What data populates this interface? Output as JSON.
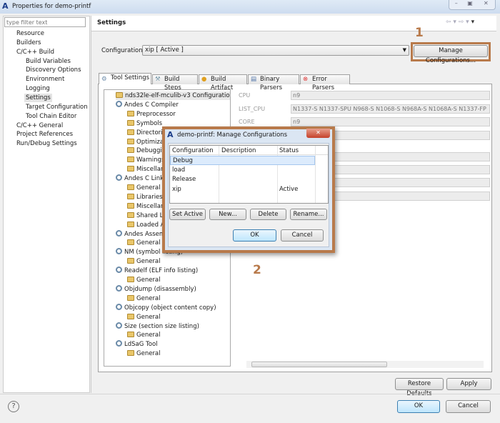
{
  "window": {
    "title": "Properties for demo-printf",
    "app_icon": "A"
  },
  "left": {
    "filter_placeholder": "type filter text",
    "items": [
      "Resource",
      "Builders",
      "C/C++ Build",
      "Build Variables",
      "Discovery Options",
      "Environment",
      "Logging",
      "Settings",
      "Target Configuration",
      "Tool Chain Editor",
      "C/C++ General",
      "Project References",
      "Run/Debug Settings"
    ]
  },
  "main": {
    "header": "Settings",
    "config_label": "Configuration:",
    "config_value": "xip  [ Active ]",
    "manage_button": "Manage Configurations...",
    "tabs": [
      "Tool Settings",
      "Build Steps",
      "Build Artifact",
      "Binary Parsers",
      "Error Parsers"
    ],
    "tree": [
      {
        "label": "nds32le-elf-mculib-v3 Configurations",
        "level": 0,
        "icon": "folder"
      },
      {
        "label": "Andes C Compiler",
        "level": 0,
        "icon": "gear"
      },
      {
        "label": "Preprocessor",
        "level": 1,
        "icon": "folder"
      },
      {
        "label": "Symbols",
        "level": 1,
        "icon": "folder"
      },
      {
        "label": "Directories",
        "level": 1,
        "icon": "folder"
      },
      {
        "label": "Optimization",
        "level": 1,
        "icon": "folder"
      },
      {
        "label": "Debugging",
        "level": 1,
        "icon": "folder"
      },
      {
        "label": "Warnings",
        "level": 1,
        "icon": "folder"
      },
      {
        "label": "Miscellaneous",
        "level": 1,
        "icon": "folder"
      },
      {
        "label": "Andes C Linker",
        "level": 0,
        "icon": "gear"
      },
      {
        "label": "General",
        "level": 1,
        "icon": "folder"
      },
      {
        "label": "Libraries",
        "level": 1,
        "icon": "folder"
      },
      {
        "label": "Miscellaneous",
        "level": 1,
        "icon": "folder"
      },
      {
        "label": "Shared Libraries",
        "level": 1,
        "icon": "folder"
      },
      {
        "label": "Loaded A",
        "level": 1,
        "icon": "folder"
      },
      {
        "label": "Andes Assembler",
        "level": 0,
        "icon": "gear"
      },
      {
        "label": "General",
        "level": 1,
        "icon": "folder"
      },
      {
        "label": "NM (symbol listing)",
        "level": 0,
        "icon": "gear"
      },
      {
        "label": "General",
        "level": 1,
        "icon": "folder"
      },
      {
        "label": "Readelf (ELF info listing)",
        "level": 0,
        "icon": "gear"
      },
      {
        "label": "General",
        "level": 1,
        "icon": "folder"
      },
      {
        "label": "Objdump (disassembly)",
        "level": 0,
        "icon": "gear"
      },
      {
        "label": "General",
        "level": 1,
        "icon": "folder"
      },
      {
        "label": "Objcopy (object content copy)",
        "level": 0,
        "icon": "gear"
      },
      {
        "label": "General",
        "level": 1,
        "icon": "folder"
      },
      {
        "label": "Size (section size listing)",
        "level": 0,
        "icon": "gear"
      },
      {
        "label": "General",
        "level": 1,
        "icon": "folder"
      },
      {
        "label": "LdSaG Tool",
        "level": 0,
        "icon": "gear"
      },
      {
        "label": "General",
        "level": 1,
        "icon": "folder"
      }
    ],
    "properties": [
      {
        "label": "CPU",
        "value": "n9"
      },
      {
        "label": "LIST_CPU",
        "value": "N1337-S N1337-SPU N968-S N1068-S N968A-S N1068A-S N1337-FP"
      },
      {
        "label": "CORE",
        "value": "n9"
      }
    ],
    "restore_defaults": "Restore Defaults",
    "apply": "Apply"
  },
  "footer": {
    "ok": "OK",
    "cancel": "Cancel"
  },
  "annotations": {
    "one": "1",
    "two": "2",
    "color": "#b87a4b"
  },
  "dialog": {
    "title": "demo-printf: Manage Configurations",
    "columns": [
      "Configuration",
      "Description",
      "Status"
    ],
    "rows": [
      {
        "name": "Debug",
        "description": "",
        "status": ""
      },
      {
        "name": "load",
        "description": "",
        "status": ""
      },
      {
        "name": "Release",
        "description": "",
        "status": ""
      },
      {
        "name": "xip",
        "description": "",
        "status": "Active"
      }
    ],
    "buttons": [
      "Set Active",
      "New...",
      "Delete",
      "Rename..."
    ],
    "ok": "OK",
    "cancel": "Cancel"
  }
}
